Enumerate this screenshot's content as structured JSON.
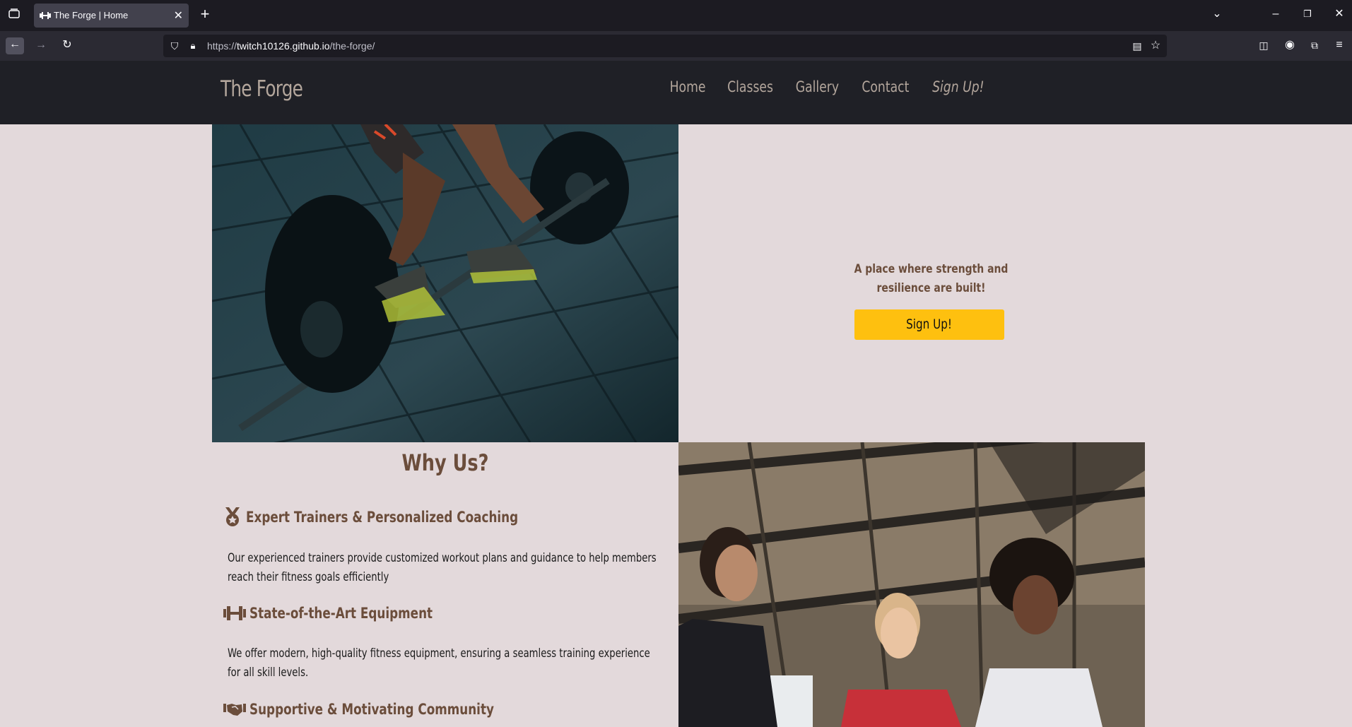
{
  "browser": {
    "tab_title": "The Forge | Home",
    "url_prefix": "https://",
    "url_domain": "twitch10126.github.io",
    "url_path": "/the-forge/"
  },
  "header": {
    "logo": "The Forge",
    "nav": [
      "Home",
      "Classes",
      "Gallery",
      "Contact",
      "Sign Up!"
    ]
  },
  "hero": {
    "tagline": "A place where strength and resilience are built!",
    "button": "Sign Up!"
  },
  "why": {
    "title": "Why Us?",
    "features": [
      {
        "icon": "medal-icon",
        "title": "Expert Trainers & Personalized Coaching",
        "desc": "Our experienced trainers provide customized workout plans and guidance to help members reach their fitness goals efficiently"
      },
      {
        "icon": "dumbbell-icon",
        "title": "State-of-the-Art Equipment",
        "desc": "We offer modern, high-quality fitness equipment, ensuring a seamless training experience for all skill levels."
      },
      {
        "icon": "handshake-icon",
        "title": "Supportive & Motivating Community",
        "desc": ""
      }
    ]
  },
  "colors": {
    "page_bg": "#e3d9db",
    "header_bg": "#1f2026",
    "accent": "#fec00f",
    "brown": "#6b4d3b"
  }
}
